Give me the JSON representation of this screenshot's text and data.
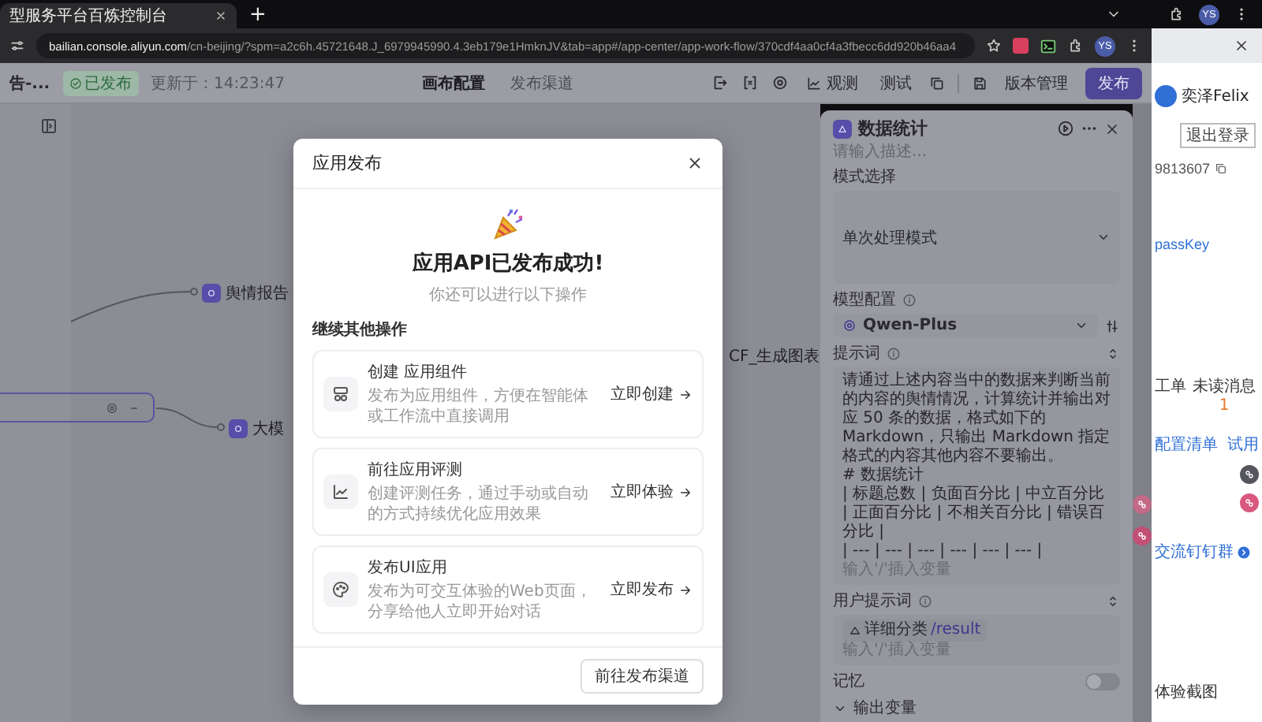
{
  "browser": {
    "tabs": [
      {
        "title": "型服务平台百炼控制台",
        "selected": true
      }
    ],
    "new_tab": "+",
    "url_host": "bailian.console.aliyun.com",
    "url_path": "/cn-beijing/?spm=a2c6h.45721648.J_6979945990.4.3eb179e1HmknJV&tab=app#/app-center/app-work-flow/370cdf4aa0cf4a3fbecc6dd920b46aa4",
    "profiles": [
      "YS",
      "YS"
    ]
  },
  "app_header": {
    "title": "告-...",
    "status": "已发布",
    "updated": "更新于：14:23:47",
    "tabs": [
      {
        "label": "画布配置",
        "selected": true
      },
      {
        "label": "发布渠道",
        "selected": false
      }
    ],
    "observe": "观测",
    "test": "测试",
    "versions": "版本管理",
    "publish": "发布"
  },
  "canvas": {
    "nodes": [
      {
        "label": "舆情报告"
      },
      {
        "label": "大模"
      },
      {
        "label": "CF_生成图表"
      }
    ]
  },
  "dialog": {
    "title": "应用发布",
    "headline": "应用API已发布成功!",
    "subtitle": "你还可以进行以下操作",
    "section": "继续其他操作",
    "cards": [
      {
        "kind": "component",
        "title": "创建 应用组件",
        "description": "发布为应用组件，方便在智能体或工作流中直接调用",
        "action": "立即创建"
      },
      {
        "kind": "evaluation",
        "title": "前往应用评测",
        "description": "创建评测任务，通过手动或自动的方式持续优化应用效果",
        "action": "立即体验"
      },
      {
        "kind": "ui",
        "title": "发布UI应用",
        "description": "发布为可交互体验的Web页面，分享给他人立即开始对话",
        "action": "立即发布"
      }
    ],
    "footer_button": "前往发布渠道"
  },
  "node_panel": {
    "title": "数据统计",
    "description_placeholder": "请输入描述...",
    "mode": {
      "label": "模式选择",
      "value": "单次处理模式"
    },
    "model": {
      "label": "模型配置",
      "value": "Qwen-Plus"
    },
    "prompt": {
      "label": "提示词",
      "lines": [
        "请通过上述内容当中的数据来判断当前的内容的舆情情况，计算统计并输出对应 50 条的数据，格式如下的 Markdown，只输出 Markdown 指定格式的内容其他内容不要输出。",
        "# 数据统计",
        "| 标题总数 | 负面百分比 | 中立百分比 | 正面百分比 | 不相关百分比 | 错误百分比 |",
        "| --- | --- | --- | --- | --- | --- |"
      ],
      "hint": "输入'/'插入变量"
    },
    "user_prompt": {
      "label": "用户提示词",
      "tag": "详细分类",
      "variable": "/result",
      "hint": "输入'/'插入变量"
    },
    "memory": {
      "label": "记忆",
      "on": false
    },
    "output": {
      "label": "输出变量"
    }
  },
  "side_window": {
    "user": "奕泽Felix",
    "logout": "退出登录",
    "account_id": "9813607",
    "api_key": "passKey",
    "stats": [
      {
        "label": "工单"
      },
      {
        "label": "未读消息",
        "value": "1"
      }
    ],
    "links": [
      "配置清单",
      "试用"
    ],
    "group_link": "交流钉钉群",
    "bottom_text": "体验截图"
  }
}
